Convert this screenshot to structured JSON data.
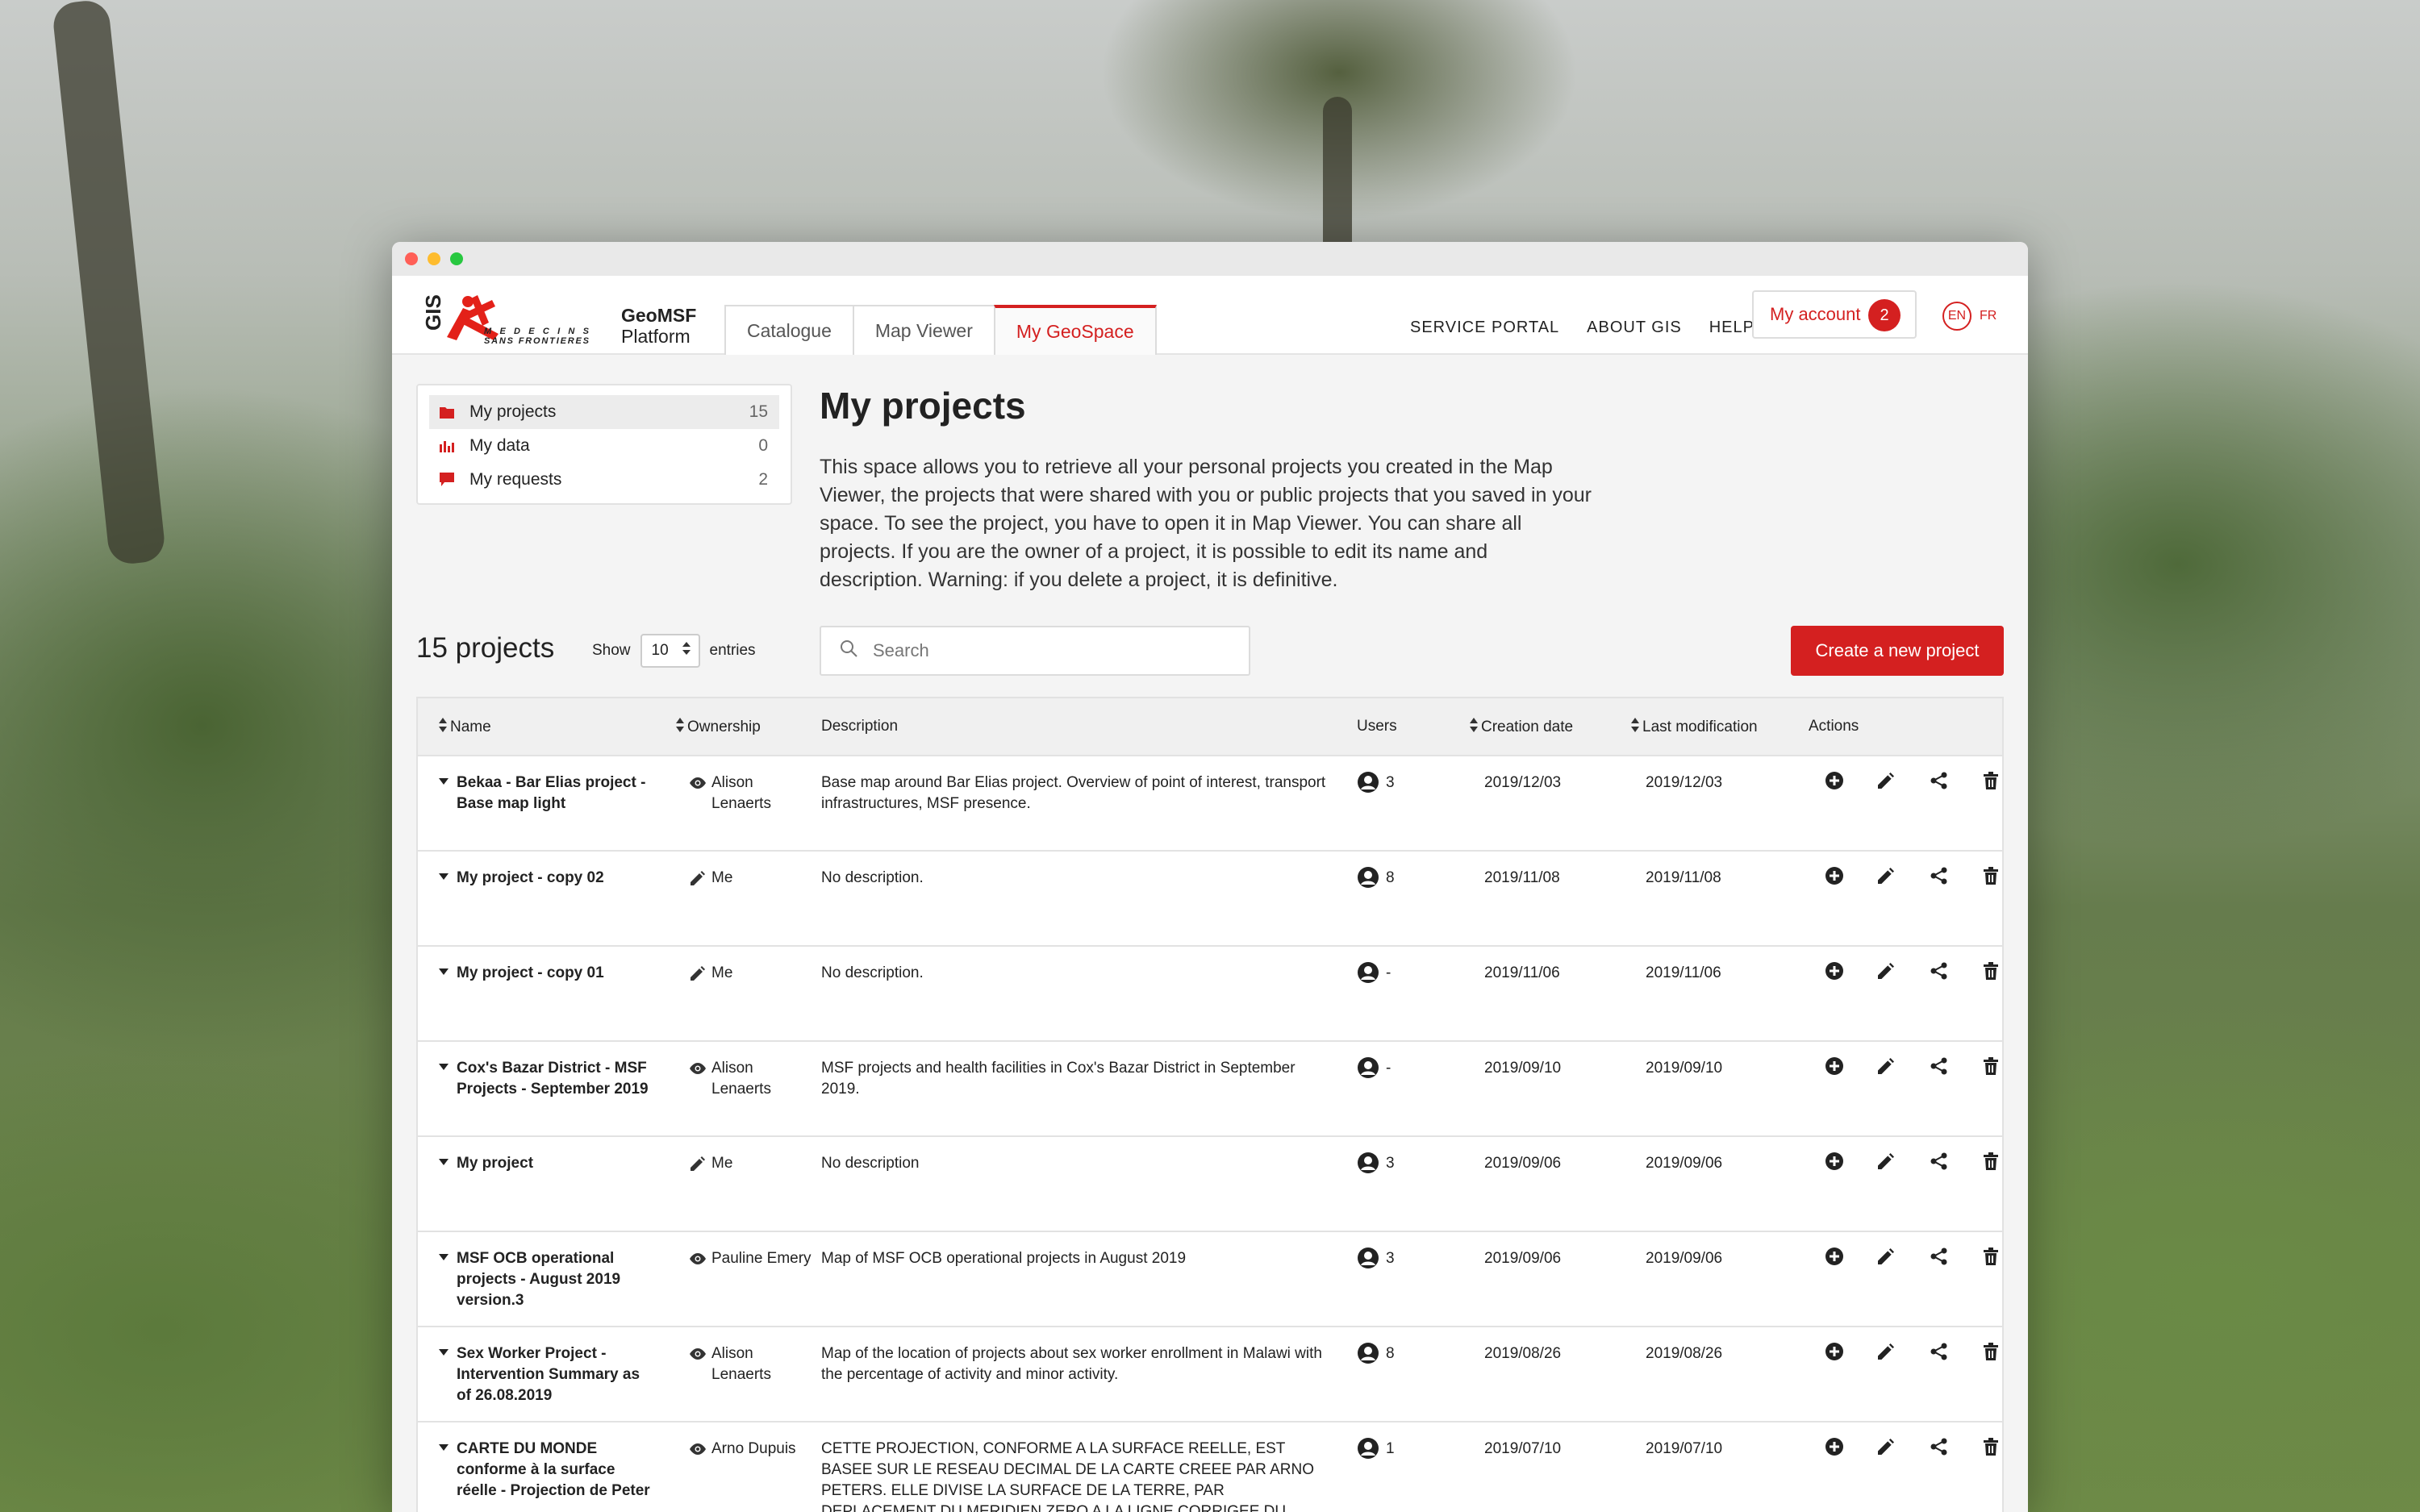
{
  "brand": {
    "logo_text": "MEDECINS SANS FRONTIERES",
    "gis": "GIS",
    "line1": "GeoMSF",
    "line2": "Platform"
  },
  "tabs": [
    {
      "label": "Catalogue"
    },
    {
      "label": "Map Viewer"
    },
    {
      "label": "My GeoSpace"
    }
  ],
  "nav": {
    "service_portal": "SERVICE PORTAL",
    "about": "ABOUT GIS",
    "help": "HELP"
  },
  "account": {
    "label": "My account",
    "badge": "2"
  },
  "lang": {
    "en": "EN",
    "fr": "FR"
  },
  "sidebar": {
    "items": [
      {
        "label": "My projects",
        "count": "15"
      },
      {
        "label": "My data",
        "count": "0"
      },
      {
        "label": "My requests",
        "count": "2"
      }
    ]
  },
  "main": {
    "title": "My projects",
    "description": "This space allows you to retrieve all your personal projects you created in the Map Viewer, the projects that were shared with you or public projects that you saved in your space. To see the project, you have to open it in Map Viewer. You can share all projects. If you are the owner of a project, it is possible to edit its name and description. Warning: if you delete a project, it is definitive.",
    "count_title": "15 projects",
    "show_label": "Show",
    "entries_value": "10",
    "entries_label": "entries",
    "search_placeholder": "Search",
    "create_label": "Create a new project"
  },
  "table": {
    "headers": {
      "name": "Name",
      "ownership": "Ownership",
      "description": "Description",
      "users": "Users",
      "creation": "Creation date",
      "modification": "Last modification",
      "actions": "Actions"
    },
    "rows": [
      {
        "name": "Bekaa - Bar Elias project - Base map light",
        "owner_icon": "eye-icon",
        "owner": "Alison Lenaerts",
        "description": "Base map around Bar Elias project. Overview of point of interest, transport infrastructures, MSF presence.",
        "users": "3",
        "created": "2019/12/03",
        "modified": "2019/12/03"
      },
      {
        "name": "My project - copy 02",
        "owner_icon": "pencil-icon",
        "owner": "Me",
        "description": "No description.",
        "users": "8",
        "created": "2019/11/08",
        "modified": "2019/11/08"
      },
      {
        "name": "My project - copy 01",
        "owner_icon": "pencil-icon",
        "owner": "Me",
        "description": "No description.",
        "users": "-",
        "created": "2019/11/06",
        "modified": "2019/11/06"
      },
      {
        "name": "Cox's Bazar District - MSF Projects - September 2019",
        "owner_icon": "eye-icon",
        "owner": "Alison Lenaerts",
        "description": "MSF projects and health facilities in Cox's Bazar District in September 2019.",
        "users": "-",
        "created": "2019/09/10",
        "modified": "2019/09/10"
      },
      {
        "name": "My project",
        "owner_icon": "pencil-icon",
        "owner": "Me",
        "description": "No description",
        "users": "3",
        "created": "2019/09/06",
        "modified": "2019/09/06"
      },
      {
        "name": "MSF OCB operational projects - August 2019 version.3",
        "owner_icon": "eye-icon",
        "owner": "Pauline Emery",
        "description": "Map of MSF OCB operational projects in August 2019",
        "users": "3",
        "created": "2019/09/06",
        "modified": "2019/09/06"
      },
      {
        "name": "Sex Worker Project - Intervention Summary as of 26.08.2019",
        "owner_icon": "eye-icon",
        "owner": "Alison Lenaerts",
        "description": "Map of the location of projects about sex worker enrollment in Malawi with the percentage of activity and minor activity.",
        "users": "8",
        "created": "2019/08/26",
        "modified": "2019/08/26"
      },
      {
        "name": "CARTE DU MONDE conforme à la surface réelle - Projection de Peter",
        "owner_icon": "eye-icon",
        "owner": "Arno Dupuis",
        "description": "CETTE PROJECTION, CONFORME A LA SURFACE REELLE, EST BASEE SUR LE RESEAU DECIMAL DE LA CARTE CREEE PAR ARNO PETERS. ELLE DIVISE LA SURFACE DE LA TERRE, PAR DEPLACEMENT DU MERIDIEN ZERO A LA LIGNE CORRIGEE DU CHANGEMENT DE DATE, EN",
        "users": "1",
        "created": "2019/07/10",
        "modified": "2019/07/10"
      }
    ]
  },
  "colors": {
    "accent": "#d42020",
    "background": "#f4f4f4"
  }
}
